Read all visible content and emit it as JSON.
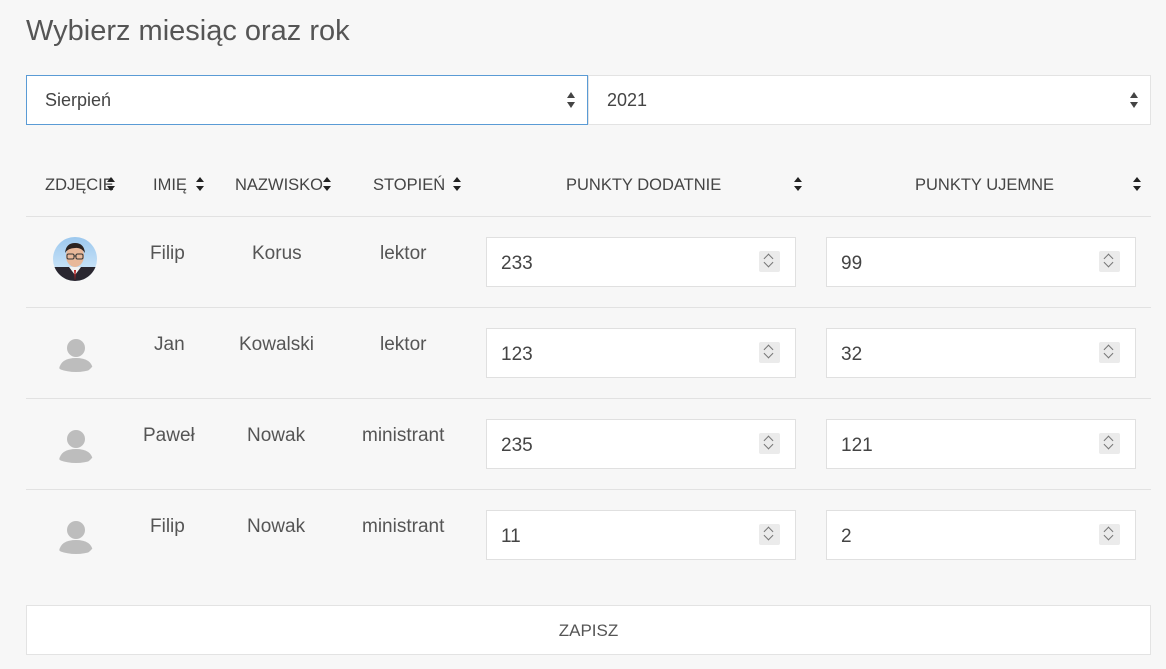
{
  "page_title": "Wybierz miesiąc oraz rok",
  "filters": {
    "month": "Sierpień",
    "year": "2021"
  },
  "table": {
    "headers": {
      "photo": "ZDJĘCIE",
      "first_name": "IMIĘ",
      "last_name": "NAZWISKO",
      "rank": "STOPIEŃ",
      "positive_points": "PUNKTY DODATNIE",
      "negative_points": "PUNKTY UJEMNE"
    },
    "rows": [
      {
        "avatar": "profile-photo",
        "first_name": "Filip",
        "last_name": "Korus",
        "rank": "lektor",
        "positive_points": "233",
        "negative_points": "99"
      },
      {
        "avatar": "default-avatar-icon",
        "first_name": "Jan",
        "last_name": "Kowalski",
        "rank": "lektor",
        "positive_points": "123",
        "negative_points": "32"
      },
      {
        "avatar": "default-avatar-icon",
        "first_name": "Paweł",
        "last_name": "Nowak",
        "rank": "ministrant",
        "positive_points": "235",
        "negative_points": "121"
      },
      {
        "avatar": "default-avatar-icon",
        "first_name": "Filip",
        "last_name": "Nowak",
        "rank": "ministrant",
        "positive_points": "11",
        "negative_points": "2"
      }
    ]
  },
  "save_label": "ZAPISZ",
  "icons": {
    "select_arrows": "select-arrows-icon",
    "sort": "sort-icon",
    "spinner": "number-spinner-icon"
  }
}
